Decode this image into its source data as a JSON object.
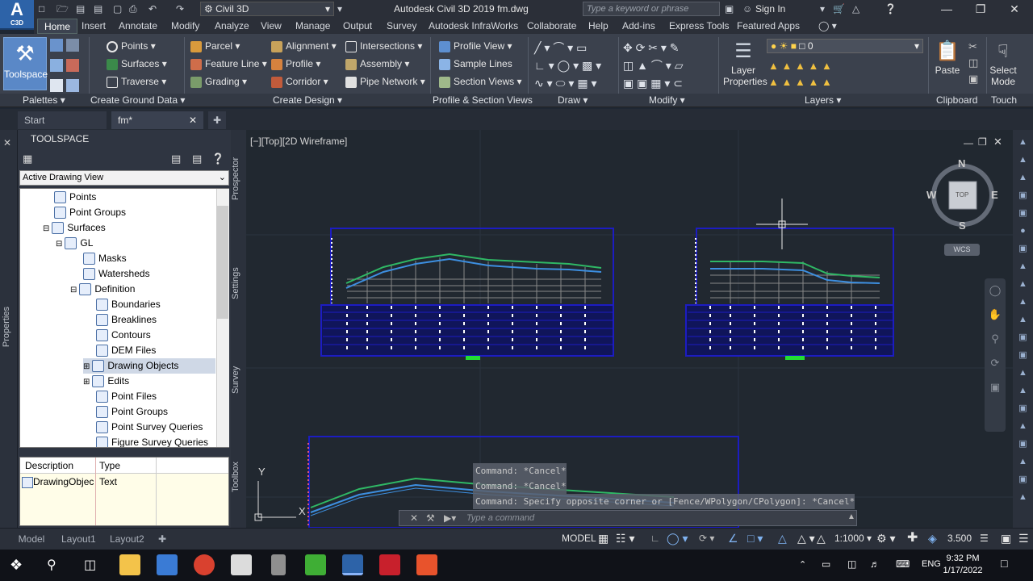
{
  "titlebar": {
    "app_icon_top": "A",
    "app_icon_bottom": "C3D",
    "workspace": "Civil 3D",
    "title": "Autodesk Civil 3D 2019    fm.dwg",
    "search_placeholder": "Type a keyword or phrase",
    "signin": "Sign In"
  },
  "menu_tabs": [
    "Home",
    "Insert",
    "Annotate",
    "Modify",
    "Analyze",
    "View",
    "Manage",
    "Output",
    "Survey",
    "Autodesk InfraWorks",
    "Collaborate",
    "Help",
    "Add-ins",
    "Express Tools",
    "Featured Apps"
  ],
  "ribbon": {
    "toolspace": "Toolspace",
    "ground": [
      "Points",
      "Surfaces",
      "Traverse"
    ],
    "design_col1": [
      "Parcel",
      "Feature Line",
      "Grading"
    ],
    "design_col2": [
      "Alignment",
      "Profile",
      "Corridor"
    ],
    "design_col3": [
      "Intersections",
      "Assembly",
      "Pipe Network"
    ],
    "profile_section": [
      "Profile View",
      "Sample Lines",
      "Section Views"
    ],
    "layer_properties": "Layer Properties",
    "layer_value": "0",
    "paste": "Paste",
    "select_mode": "Select Mode",
    "panels": [
      "Palettes",
      "Create Ground Data",
      "Create Design",
      "Profile & Section Views",
      "Draw",
      "Modify",
      "Layers",
      "Clipboard",
      "Touch"
    ]
  },
  "doc_tabs": [
    "Start",
    "fm*"
  ],
  "toolspace": {
    "title": "TOOLSPACE",
    "view": "Active Drawing View",
    "side_tab": "Properties",
    "vtabs": [
      "Prospector",
      "Settings",
      "Survey",
      "Toolbox"
    ],
    "tree": [
      "Points",
      "Point Groups",
      "Surfaces",
      "GL",
      "Masks",
      "Watersheds",
      "Definition",
      "Boundaries",
      "Breaklines",
      "Contours",
      "DEM Files",
      "Drawing Objects",
      "Edits",
      "Point Files",
      "Point Groups",
      "Point Survey Queries",
      "Figure Survey Queries"
    ],
    "desc_headers": [
      "Description",
      "Type"
    ],
    "desc_row": [
      "DrawingObjec",
      "Text"
    ]
  },
  "viewport": {
    "label": "[−][Top][2D Wireframe]",
    "compass": {
      "n": "N",
      "s": "S",
      "e": "E",
      "w": "W",
      "top": "TOP"
    },
    "wcs": "WCS",
    "y_axis": "Y",
    "x_axis": "X"
  },
  "command": {
    "history": [
      "Command: *Cancel*",
      "Command: *Cancel*",
      "Command: Specify opposite corner or [Fence/WPolygon/CPolygon]: *Cancel*"
    ],
    "placeholder": "Type a command"
  },
  "status": {
    "layouts": [
      "Model",
      "Layout1",
      "Layout2"
    ],
    "model": "MODEL",
    "scale": "1:1000",
    "annot": "3.500"
  },
  "taskbar": {
    "lang": "ENG",
    "time": "9:32 PM",
    "date": "1/17/2022"
  }
}
